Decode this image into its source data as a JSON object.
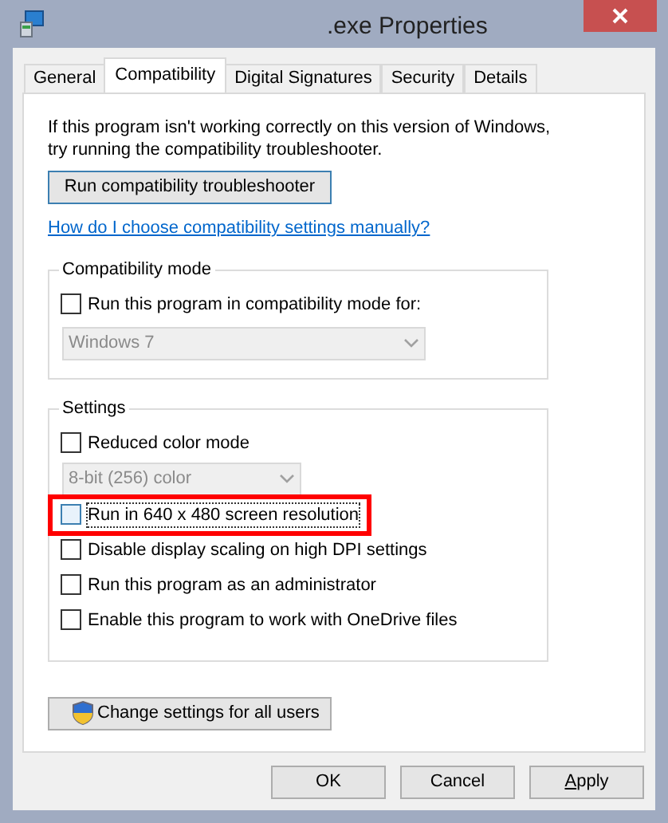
{
  "window": {
    "title": ".exe Properties"
  },
  "tabs": [
    {
      "label": "General",
      "selected": false
    },
    {
      "label": "Compatibility",
      "selected": true
    },
    {
      "label": "Digital Signatures",
      "selected": false
    },
    {
      "label": "Security",
      "selected": false
    },
    {
      "label": "Details",
      "selected": false
    }
  ],
  "intro": "If this program isn't working correctly on this version of Windows, try running the compatibility troubleshooter.",
  "troubleshooter_button": "Run compatibility troubleshooter",
  "help_link": "How do I choose compatibility settings manually?",
  "compatibility_mode": {
    "title": "Compatibility mode",
    "option": {
      "label": "Run this program in compatibility mode for:",
      "checked": false
    },
    "dropdown": {
      "value": "Windows 7",
      "disabled": true
    }
  },
  "settings": {
    "title": "Settings",
    "items": [
      {
        "kind": "checkbox",
        "label": "Reduced color mode",
        "checked": false,
        "focused": false,
        "highlighted": false
      },
      {
        "kind": "dropdown",
        "value": "8-bit (256) color",
        "disabled": true
      },
      {
        "kind": "checkbox",
        "label": "Run in 640 x 480 screen resolution",
        "checked": false,
        "focused": true,
        "highlighted": true
      },
      {
        "kind": "checkbox",
        "label": "Disable display scaling on high DPI settings",
        "checked": false,
        "focused": false,
        "highlighted": false
      },
      {
        "kind": "checkbox",
        "label": "Run this program as an administrator",
        "checked": false,
        "focused": false,
        "highlighted": false
      },
      {
        "kind": "checkbox",
        "label": "Enable this program to work with OneDrive files",
        "checked": false,
        "focused": false,
        "highlighted": false
      }
    ]
  },
  "all_users_button": "Change settings for all users",
  "buttons": [
    {
      "label": "OK",
      "mnemonic": false
    },
    {
      "label": "Cancel",
      "mnemonic": false
    },
    {
      "label": "Apply",
      "mnemonic": true
    }
  ]
}
